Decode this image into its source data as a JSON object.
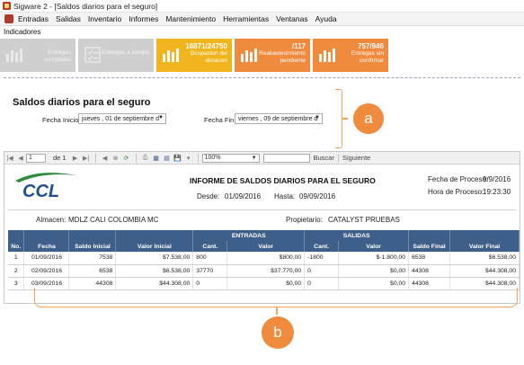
{
  "window": {
    "title": "Sigware 2 - [Saldos diarios para el seguro]"
  },
  "menu": [
    "Entradas",
    "Salidas",
    "Inventario",
    "Informes",
    "Mantenimiento",
    "Herramientas",
    "Ventanas",
    "Ayuda"
  ],
  "indicators": {
    "label": "Indicadores",
    "cards": [
      {
        "value": "",
        "line1": "Entregas",
        "line2": "completas",
        "color": "grey",
        "icon": "bar-chart-icon"
      },
      {
        "value": "",
        "line1": "Entregas a tiempo",
        "line2": "",
        "color": "grey",
        "icon": "checklist-icon"
      },
      {
        "value": "16871/24750",
        "line1": "Ocupacion del",
        "line2": "almacen",
        "color": "yellow",
        "icon": "bar-chart-icon"
      },
      {
        "value": "/117",
        "line1": "Reabastecimiento",
        "line2": "pendiente",
        "color": "orange",
        "icon": "bar-chart-icon"
      },
      {
        "value": "757/946",
        "line1": "Entregas sin",
        "line2": "confirmar",
        "color": "orange",
        "icon": "bar-chart-icon"
      }
    ]
  },
  "panel": {
    "title": "Saldos diarios para el seguro",
    "fecha_inicio_label": "Fecha Inicio",
    "fecha_inicio_value": "jueves , 01 de septiembre d",
    "fecha_fin_label": "Fecha Fin",
    "fecha_fin_value": "viernes , 09 de septiembre d"
  },
  "callouts": {
    "a": "a",
    "b": "b"
  },
  "toolbar": {
    "page": "1",
    "of": "de 1",
    "zoom": "100%",
    "search": "Buscar",
    "next": "Siguiente"
  },
  "report": {
    "logo_text": "CCL",
    "title": "INFORME DE SALDOS DIARIOS PARA EL SEGURO",
    "desde_label": "Desde:",
    "desde_value": "01/09/2016",
    "hasta_label": "Hasta:",
    "hasta_value": "09/09/2016",
    "fecha_proceso_label": "Fecha de Proceso:",
    "fecha_proceso_value": "9/9/2016",
    "hora_proceso_label": "Hora de Proceso:",
    "hora_proceso_value": "19:23:30",
    "almacen_label": "Almacen:",
    "almacen_value": "MDLZ CALI COLOMBIA MC",
    "propietario_label": "Propietario:",
    "propietario_value": "CATALYST PRUEBAS",
    "group_headers": {
      "entradas": "ENTRADAS",
      "salidas": "SALIDAS"
    },
    "columns": [
      "No.",
      "Fecha",
      "Saldo Inicial",
      "Valor Inicial",
      "Cant.",
      "Valor",
      "Cant.",
      "Valor",
      "Saldo Final",
      "Valor Final"
    ],
    "rows": [
      [
        "1",
        "01/09/2016",
        "7538",
        "$7.538,00",
        "800",
        "$800,00",
        "-1800",
        "$-1.800,00",
        "6538",
        "$6.538,00"
      ],
      [
        "2",
        "02/09/2016",
        "6538",
        "$6.538,00",
        "37770",
        "$37.770,00",
        "0",
        "$0,00",
        "44308",
        "$44.308,00"
      ],
      [
        "3",
        "03/09/2016",
        "44308",
        "$44.308,00",
        "0",
        "$0,00",
        "0",
        "$0,00",
        "44308",
        "$44.308,00"
      ]
    ]
  }
}
